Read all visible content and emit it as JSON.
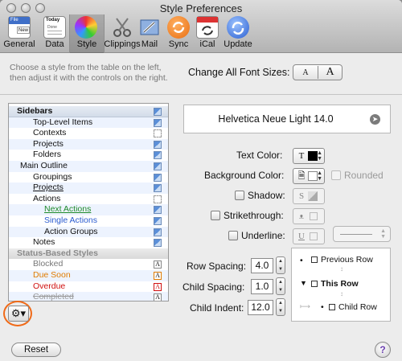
{
  "window": {
    "title": "Style Preferences"
  },
  "toolbar": {
    "items": [
      {
        "label": "General",
        "icon": "general-icon"
      },
      {
        "label": "Data",
        "icon": "data-icon"
      },
      {
        "label": "Style",
        "icon": "style-icon",
        "selected": true
      },
      {
        "label": "Clippings",
        "icon": "clippings-icon"
      },
      {
        "label": "Mail",
        "icon": "mail-icon"
      },
      {
        "label": "Sync",
        "icon": "sync-icon"
      },
      {
        "label": "iCal",
        "icon": "ical-icon"
      },
      {
        "label": "Update",
        "icon": "update-icon"
      }
    ],
    "general_icon_text": {
      "file": "File",
      "new": "New"
    },
    "data_icon_text": {
      "today": "Today",
      "done": "Done"
    }
  },
  "instructions": "Choose a style from the table on the left, then adjust it with the controls on the right.",
  "font_sizes": {
    "label": "Change All Font Sizes:",
    "smaller": "A",
    "larger": "A"
  },
  "style_table": {
    "rows": [
      {
        "label": "Sidebars",
        "kind": "header"
      },
      {
        "label": "Top-Level Items",
        "indent": 1
      },
      {
        "label": "Contexts",
        "indent": 1
      },
      {
        "label": "Projects",
        "indent": 1
      },
      {
        "label": "Folders",
        "indent": 1
      },
      {
        "label": "Main Outline",
        "indent": 0
      },
      {
        "label": "Groupings",
        "indent": 1
      },
      {
        "label": "Projects",
        "indent": 1
      },
      {
        "label": "Actions",
        "indent": 1
      },
      {
        "label": "Next Actions",
        "indent": 2
      },
      {
        "label": "Single Actions",
        "indent": 2
      },
      {
        "label": "Action Groups",
        "indent": 2
      },
      {
        "label": "Notes",
        "indent": 1
      },
      {
        "label": "Status-Based Styles",
        "kind": "subheader"
      },
      {
        "label": "Blocked",
        "indent": 1
      },
      {
        "label": "Due Soon",
        "indent": 1
      },
      {
        "label": "Overdue",
        "indent": 1
      },
      {
        "label": "Completed",
        "indent": 1
      }
    ],
    "swatch_letter": "A"
  },
  "colors": {
    "next_actions": "#1e8a2a",
    "single_actions": "#2a5bd0",
    "due_soon": "#e07b00",
    "overdue": "#d01010",
    "blocked": "#777777",
    "completed": "#9a9a9a",
    "accent_orange": "#f06a18"
  },
  "font_button": {
    "label": "Helvetica Neue Light 14.0"
  },
  "text_color": {
    "label": "Text Color:",
    "glyph": "T"
  },
  "background_color": {
    "label": "Background Color:"
  },
  "rounded": {
    "label": "Rounded"
  },
  "shadow": {
    "label": "Shadow:",
    "glyph": "S"
  },
  "strikethrough": {
    "label": "Strikethrough:",
    "glyph": "ᴥ"
  },
  "underline": {
    "label": "Underline:",
    "glyph": "U"
  },
  "spacing": {
    "row": {
      "label": "Row Spacing:",
      "value": "4.0"
    },
    "child": {
      "label": "Child Spacing:",
      "value": "1.0"
    },
    "indent": {
      "label": "Child Indent:",
      "value": "12.0"
    }
  },
  "preview": {
    "previous_row": "Previous Row",
    "this_row": "This Row",
    "child_row": "Child Row"
  },
  "buttons": {
    "reset": "Reset",
    "help": "?",
    "gear": "⚙▾"
  }
}
